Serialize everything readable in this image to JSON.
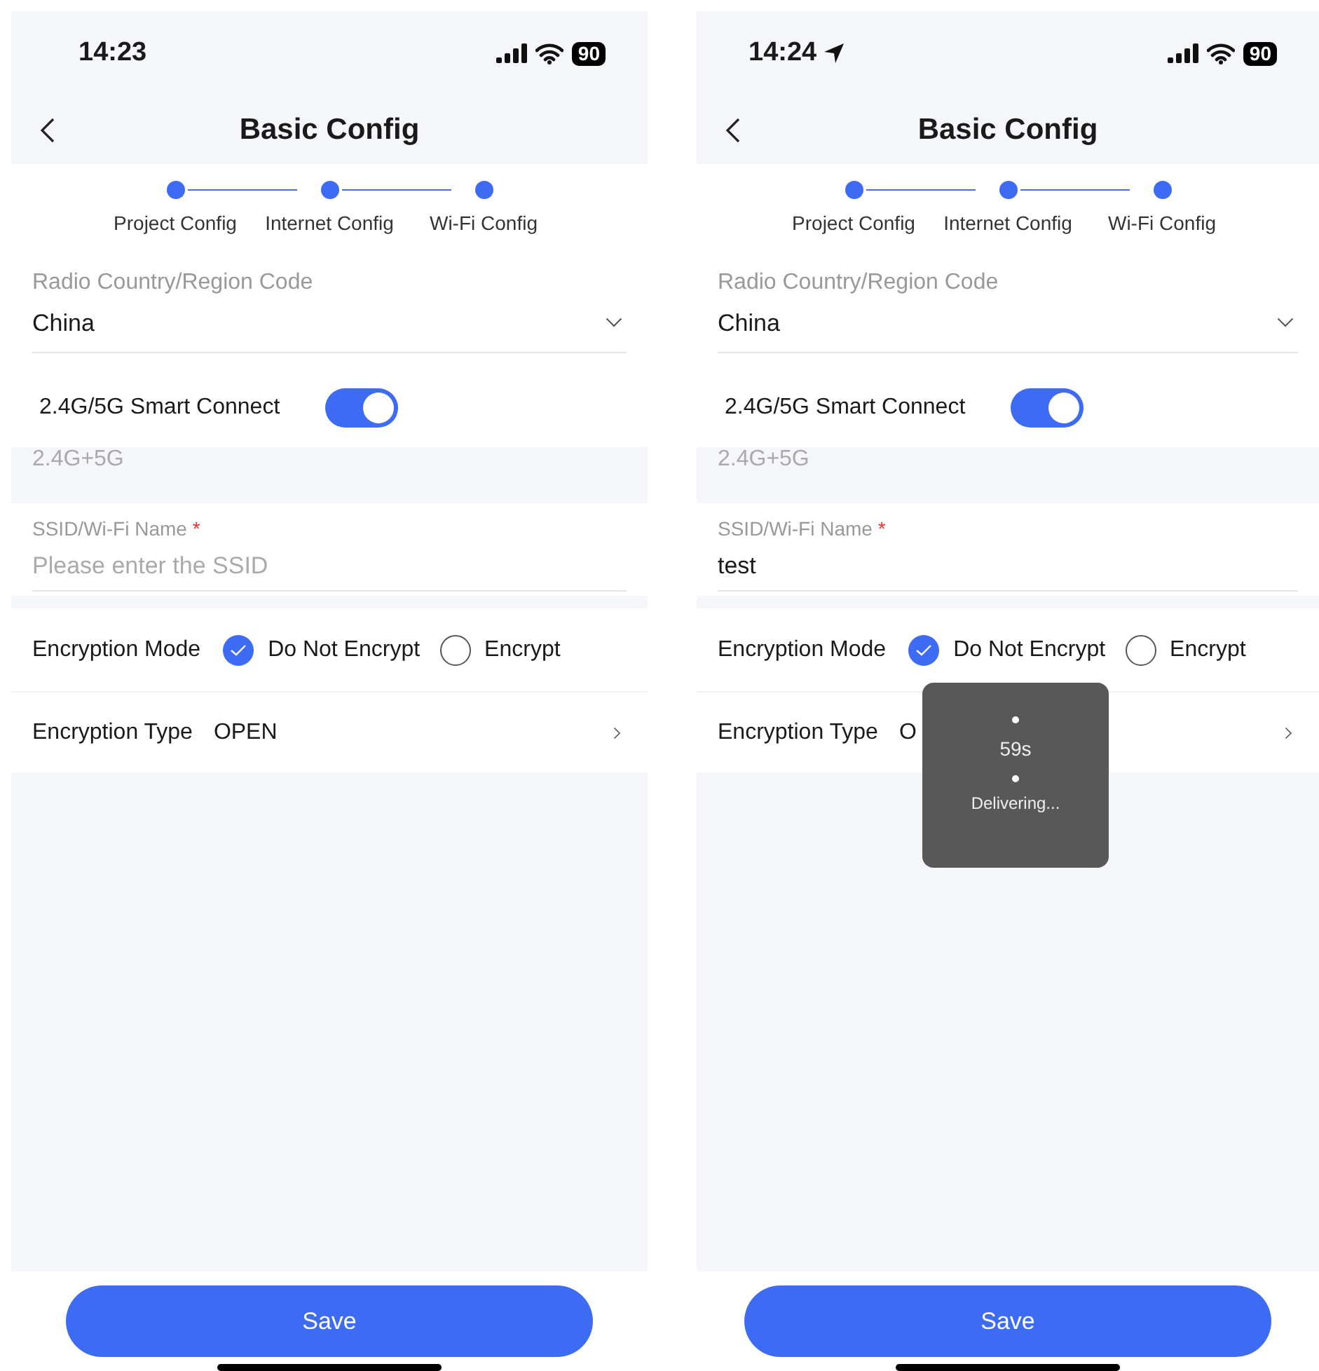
{
  "screens": [
    {
      "status_bar": {
        "time": "14:23",
        "location": false,
        "battery": "90"
      },
      "title": "Basic Config",
      "steps": [
        {
          "label": "Project Config"
        },
        {
          "label": "Internet Config"
        },
        {
          "label": "Wi-Fi Config"
        }
      ],
      "region": {
        "label": "Radio Country/Region Code",
        "value": "China"
      },
      "smart_connect": {
        "label": "2.4G/5G Smart Connect",
        "on": true
      },
      "band": "2.4G+5G",
      "ssid": {
        "label": "SSID/Wi-Fi Name",
        "required": "*",
        "placeholder": "Please enter the SSID"
      },
      "encryption_mode": {
        "label": "Encryption Mode",
        "options": [
          {
            "label": "Do Not Encrypt",
            "selected": true
          },
          {
            "label": "Encrypt",
            "selected": false
          }
        ]
      },
      "encryption_type": {
        "label": "Encryption Type",
        "value": "OPEN"
      },
      "save_button": "Save"
    },
    {
      "status_bar": {
        "time": "14:24",
        "location": true,
        "battery": "90"
      },
      "title": "Basic Config",
      "steps": [
        {
          "label": "Project Config"
        },
        {
          "label": "Internet Config"
        },
        {
          "label": "Wi-Fi Config"
        }
      ],
      "region": {
        "label": "Radio Country/Region Code",
        "value": "China"
      },
      "smart_connect": {
        "label": "2.4G/5G Smart Connect",
        "on": true
      },
      "band": "2.4G+5G",
      "ssid": {
        "label": "SSID/Wi-Fi Name",
        "required": "*",
        "value": "test"
      },
      "encryption_mode": {
        "label": "Encryption Mode",
        "options": [
          {
            "label": "Do Not Encrypt",
            "selected": true
          },
          {
            "label": "Encrypt",
            "selected": false
          }
        ]
      },
      "encryption_type": {
        "label": "Encryption Type",
        "value": "O"
      },
      "toast": {
        "countdown": "59s",
        "message": "Delivering..."
      },
      "save_button": "Save"
    }
  ]
}
